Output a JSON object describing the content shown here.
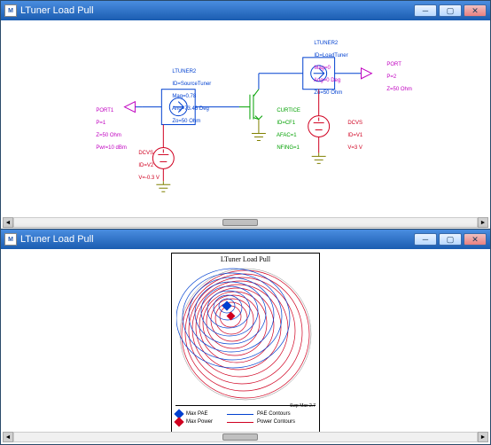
{
  "win1": {
    "title": "LTuner Load Pull",
    "port1": {
      "hdr": "PORT1",
      "l1": "P=1",
      "l2": "Z=50 Ohm",
      "l3": "Pwr=10 dBm"
    },
    "lt1": {
      "hdr": "LTUNER2",
      "l1": "ID=SourceTuner",
      "l2": "Mag=0.78",
      "l3": "Ang=73.46 Deg",
      "l4": "Zo=50 Ohm"
    },
    "dc1": {
      "hdr": "DCVS",
      "l1": "ID=V2",
      "l2": "V=-0.3 V"
    },
    "fet": {
      "hdr": "CURTICE",
      "l1": "ID=CF1",
      "l2": "AFAC=1",
      "l3": "NFING=1"
    },
    "lt2": {
      "hdr": "LTUNER2",
      "l1": "ID=LoadTuner",
      "l2": "Mag=0",
      "l3": "Ang=0 Deg",
      "l4": "Zo=50 Ohm"
    },
    "dc2": {
      "hdr": "DCVS",
      "l1": "ID=V1",
      "l2": "V=3 V"
    },
    "port2": {
      "hdr": "PORT",
      "l1": "P=2",
      "l2": "Z=50 Ohm"
    }
  },
  "win2": {
    "title": "LTuner Load Pull",
    "plot_title": "LTuner Load Pull",
    "legend": {
      "maxpae": "Max PAE",
      "paec": "PAE Contours",
      "maxpwr": "Max Power",
      "pwrc": "Power Contours"
    },
    "swp": "Swp Max\n2.7"
  }
}
